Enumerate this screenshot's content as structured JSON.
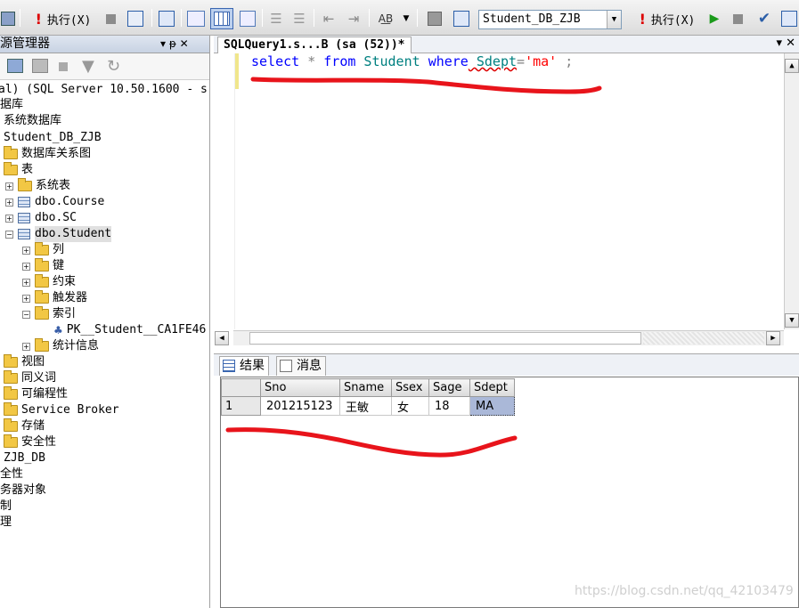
{
  "toolbar": {
    "execute_label": "执行(X)",
    "execute_label_2": "执行(X)",
    "database_selected": "Student_DB_ZJB"
  },
  "explorer": {
    "title": "源管理器",
    "pin_label": "▾ ᵽ ✕",
    "nodes": {
      "server": "al) (SQL Server 10.50.1600 - s",
      "databases": "据库",
      "system_db": "系统数据库",
      "student_db": "Student_DB_ZJB",
      "diagrams": "数据库关系图",
      "tables": "表",
      "system_tables": "系统表",
      "course": "dbo.Course",
      "sc": "dbo.SC",
      "student": "dbo.Student",
      "columns": "列",
      "keys": "键",
      "constraints": "约束",
      "triggers": "触发器",
      "indexes": "索引",
      "pk": "PK__Student__CA1FE46",
      "statistics": "统计信息",
      "views": "视图",
      "synonyms": "同义词",
      "programmability": "可编程性",
      "service_broker": "Service Broker",
      "storage": "存储",
      "security": "安全性",
      "zjb_db": "ZJB_DB",
      "security2": "全性",
      "server_objects": "务器对象",
      "replication": "制",
      "management": "理"
    }
  },
  "editor": {
    "tab_label": "SQLQuery1.s...B (sa (52))*",
    "tab_controls": "▾ ✕",
    "code": {
      "select": "select",
      "star": " * ",
      "from": "from",
      "table": " Student ",
      "where": "where",
      "column": " Sdept",
      "eq": "=",
      "value": "'ma'",
      "semi": " ;"
    }
  },
  "results": {
    "tab_results": "结果",
    "tab_messages": "消息",
    "columns": [
      "Sno",
      "Sname",
      "Ssex",
      "Sage",
      "Sdept"
    ],
    "rows": [
      {
        "num": "1",
        "Sno": "201215123",
        "Sname": "王敏",
        "Ssex": "女",
        "Sage": "18",
        "Sdept": "MA"
      }
    ]
  },
  "watermark": "https://blog.csdn.net/qq_42103479",
  "colors": {
    "keyword": "#0000ff",
    "object": "#008080",
    "string": "#ff0000",
    "annotation": "#e8141b"
  }
}
